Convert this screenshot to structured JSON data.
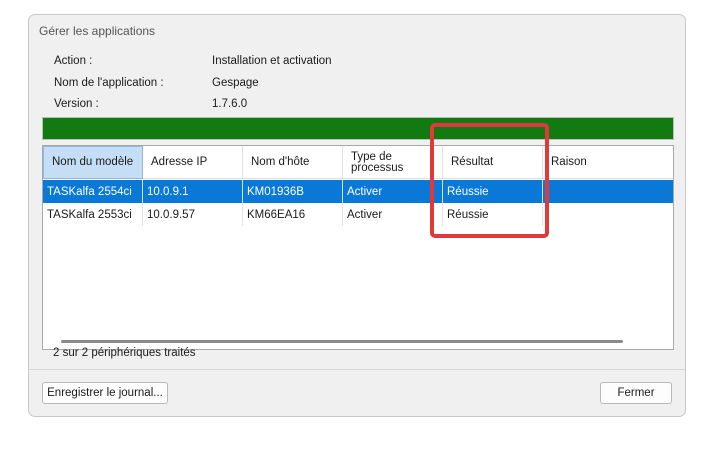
{
  "dialog": {
    "title": "Gérer les applications"
  },
  "info": {
    "action_label": "Action :",
    "action_value": "Installation et activation",
    "app_name_label": "Nom de l'application :",
    "app_name_value": "Gespage",
    "version_label": "Version :",
    "version_value": "1.7.6.0"
  },
  "progress": {
    "percent": 100,
    "color": "#117a11"
  },
  "table": {
    "columns": [
      "Nom du modèle",
      "Adresse IP",
      "Nom d'hôte",
      "Type de processus",
      "Résultat",
      "Raison"
    ],
    "rows": [
      [
        "TASKalfa 2554ci",
        "10.0.9.1",
        "KM01936B",
        "Activer",
        "Réussie",
        ""
      ],
      [
        "TASKalfa 2553ci",
        "10.0.9.57",
        "KM66EA16",
        "Activer",
        "Réussie",
        ""
      ]
    ],
    "selected_row": 0
  },
  "status": {
    "text": "2 sur 2 périphériques traités"
  },
  "buttons": {
    "save_log": "Enregistrer le journal...",
    "close": "Fermer"
  },
  "colors": {
    "selection": "#0a78d7",
    "highlight": "#e0393b"
  }
}
